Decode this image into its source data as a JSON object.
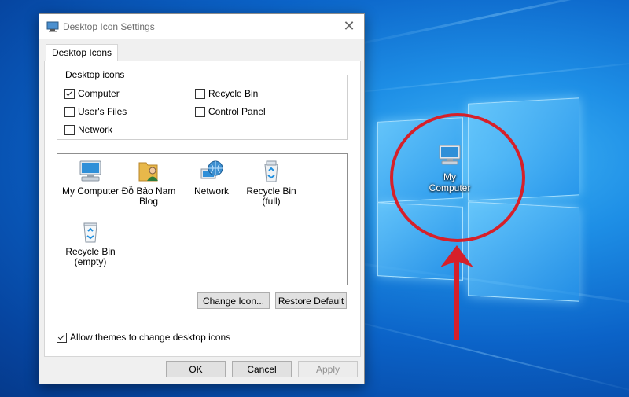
{
  "dialog": {
    "title": "Desktop Icon Settings",
    "tab_label": "Desktop Icons",
    "group_title": "Desktop icons",
    "checkboxes": [
      {
        "label": "Computer",
        "checked": true
      },
      {
        "label": "Recycle Bin",
        "checked": false
      },
      {
        "label": "User's Files",
        "checked": false
      },
      {
        "label": "Control Panel",
        "checked": false
      },
      {
        "label": "Network",
        "checked": false
      }
    ],
    "icons": [
      {
        "label": "My Computer",
        "icon": "computer-icon"
      },
      {
        "label": "Đỗ Bảo Nam Blog",
        "icon": "user-folder-icon"
      },
      {
        "label": "Network",
        "icon": "network-globe-icon"
      },
      {
        "label": "Recycle Bin (full)",
        "icon": "recycle-bin-full-icon"
      },
      {
        "label": "Recycle Bin (empty)",
        "icon": "recycle-bin-empty-icon"
      }
    ],
    "change_icon_label": "Change Icon...",
    "restore_default_label": "Restore Default",
    "allow_themes_label": "Allow themes to change desktop icons",
    "allow_themes_checked": true,
    "ok_label": "OK",
    "cancel_label": "Cancel",
    "apply_label": "Apply"
  },
  "desktop": {
    "icon_label": "My Computer",
    "icon": "computer-icon",
    "highlight_color": "#d6202a"
  }
}
